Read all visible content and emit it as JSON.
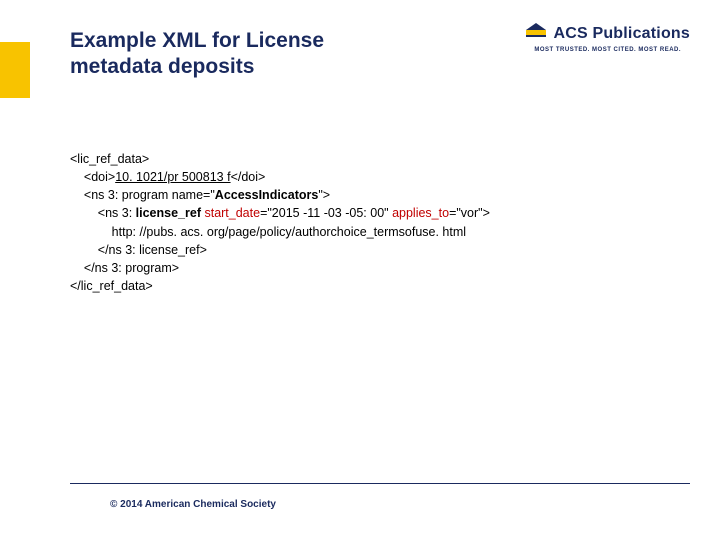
{
  "header": {
    "title_line1": "Example XML for License",
    "title_line2": "metadata deposits",
    "logo_text": "ACS Publications",
    "logo_tagline": "MOST TRUSTED. MOST CITED. MOST READ."
  },
  "xml": {
    "l01": "<lic_ref_data>",
    "l02_a": "    <doi>",
    "l02_doi": "10. 1021/pr 500813 f",
    "l02_b": "</doi>",
    "l03_a": "    <ns 3: program name=\"",
    "l03_attr": "AccessIndicators",
    "l03_b": "\">",
    "l04_a": "        <ns 3: ",
    "l04_lic": "license_ref",
    "l04_b": " ",
    "l04_sd_k": "start_date",
    "l04_sd_v": "=\"2015 -11 -03 -05: 00\" ",
    "l04_at_k": "applies_to",
    "l04_at_v": "=\"vor\">",
    "l05": "            http: //pubs. acs. org/page/policy/authorchoice_termsofuse. html",
    "l06": "        </ns 3: license_ref>",
    "l07": "    </ns 3: program>",
    "l08": "</lic_ref_data>"
  },
  "footer": {
    "copyright": "© 2014 American Chemical Society"
  },
  "colors": {
    "brand": "#1a2a5e",
    "accent": "#f8c300",
    "attr_red": "#c00000"
  }
}
